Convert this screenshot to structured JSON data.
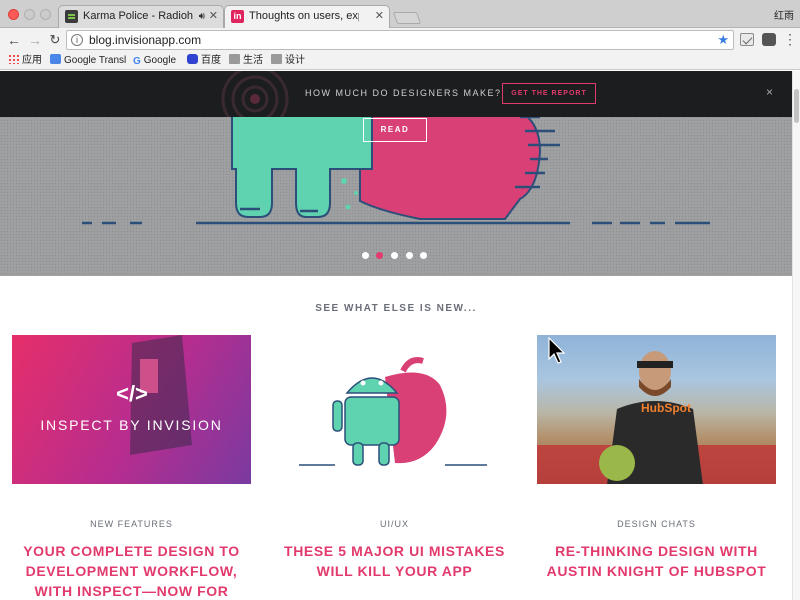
{
  "browser": {
    "tabs": [
      {
        "title": "Karma Police - Radiohead",
        "favicon": "spotify-icon",
        "playing_audio": true
      },
      {
        "title": "Thoughts on users, experience",
        "favicon": "invision-icon",
        "active": true
      }
    ],
    "favicon_letter": "in",
    "profile_name": "红雨",
    "url": "blog.invisionapp.com",
    "bookmarks": [
      "应用",
      "Google Transl",
      "Google",
      "百度",
      "生活",
      "设计"
    ]
  },
  "promo": {
    "text": "HOW MUCH DO DESIGNERS MAKE?",
    "button": "GET THE REPORT",
    "close": "×"
  },
  "hero": {
    "button": "READ",
    "slides": 5,
    "active_slide": 2
  },
  "section_title": "SEE WHAT ELSE IS NEW...",
  "cards": [
    {
      "category": "NEW FEATURES",
      "headline": "YOUR COMPLETE DESIGN TO DEVELOPMENT WORKFLOW, WITH INSPECT—NOW FOR",
      "thumb_text": "INSPECT BY INVISION",
      "thumb_icon": "</>"
    },
    {
      "category": "UI/UX",
      "headline": "THESE 5 MAJOR UI MISTAKES WILL KILL YOUR APP"
    },
    {
      "category": "DESIGN CHATS",
      "headline": "RE-THINKING DESIGN WITH AUSTIN KNIGHT OF HUBSPOT",
      "thumb_text": "HubSpot"
    }
  ],
  "colors": {
    "accent": "#e23a6c",
    "hero_bg": "#9ea0a2",
    "promo_bg": "#1c1d1f",
    "mint": "#5fd3b0",
    "pink": "#d94076"
  }
}
